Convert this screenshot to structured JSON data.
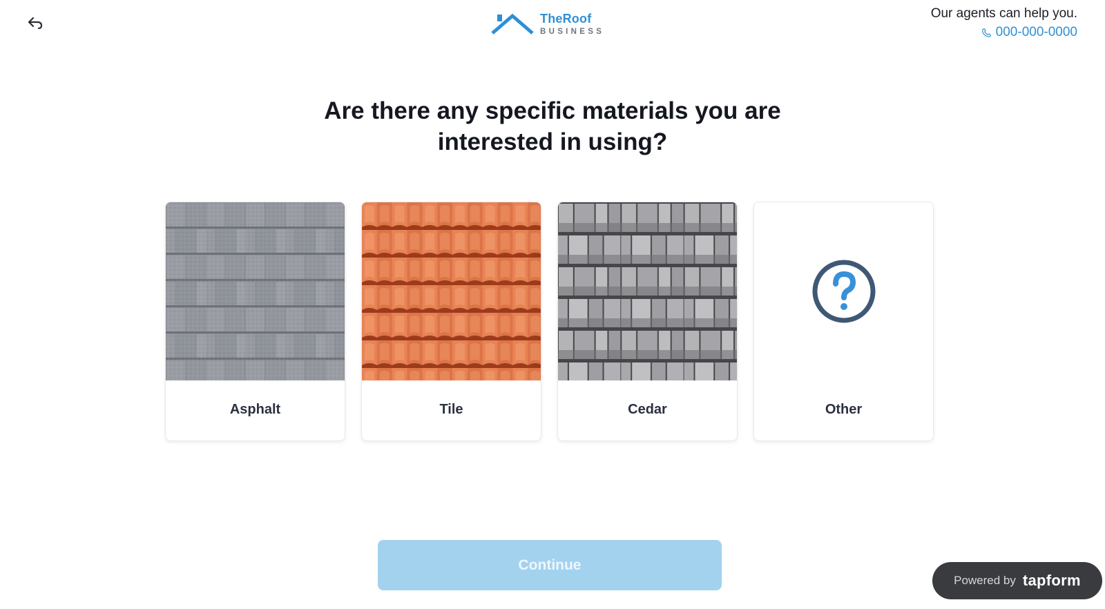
{
  "header": {
    "back_icon": "undo-arrow-icon",
    "logo": {
      "name": "TheRoof",
      "sub": "BUSINESS",
      "icon": "roof-logo-icon"
    },
    "help_text": "Our agents can help you.",
    "phone_icon": "phone-icon",
    "phone": "000-000-0000"
  },
  "question": "Are there any specific materials you are interested in using?",
  "options": [
    {
      "label": "Asphalt",
      "image": "asphalt-shingles"
    },
    {
      "label": "Tile",
      "image": "terracotta-tiles"
    },
    {
      "label": "Cedar",
      "image": "cedar-shakes"
    },
    {
      "label": "Other",
      "icon": "question-mark-icon"
    }
  ],
  "continue_label": "Continue",
  "footer": {
    "powered_label": "Powered by",
    "brand": "tapform"
  },
  "colors": {
    "accent": "#2f8fd6",
    "button_disabled": "#a3d2ee",
    "badge": "#3a3b3f"
  }
}
